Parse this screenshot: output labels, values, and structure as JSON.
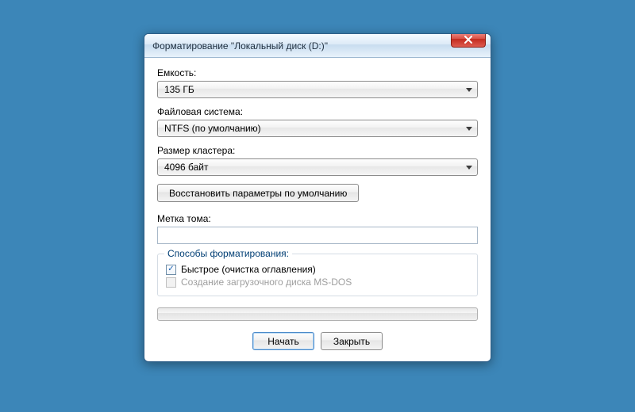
{
  "window": {
    "title": "Форматирование \"Локальный диск (D:)\""
  },
  "labels": {
    "capacity": "Емкость:",
    "filesystem": "Файловая система:",
    "cluster": "Размер кластера:",
    "volume_label": "Метка тома:",
    "group_options": "Способы форматирования:"
  },
  "fields": {
    "capacity_value": "135 ГБ",
    "filesystem_value": "NTFS (по умолчанию)",
    "cluster_value": "4096 байт",
    "volume_label_value": ""
  },
  "buttons": {
    "restore_defaults": "Восстановить параметры по умолчанию",
    "start": "Начать",
    "close": "Закрыть"
  },
  "options": {
    "quick_format": "Быстрое (очистка оглавления)",
    "msdos_boot": "Создание загрузочного диска MS-DOS",
    "quick_format_checked": true,
    "msdos_boot_enabled": false
  },
  "colors": {
    "desktop": "#3c86b8",
    "close_btn": "#c32b1e"
  }
}
